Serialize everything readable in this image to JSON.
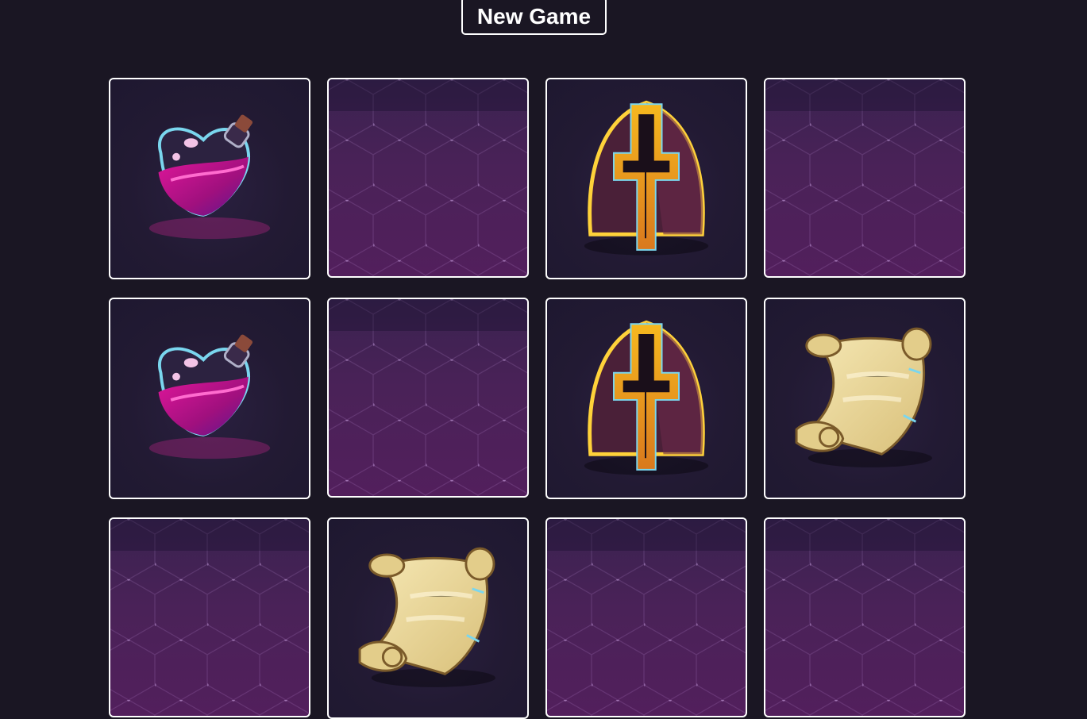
{
  "header": {
    "new_game_label": "New Game"
  },
  "board": {
    "cards": [
      {
        "state": "face-up",
        "item": "potion"
      },
      {
        "state": "face-down"
      },
      {
        "state": "face-up",
        "item": "helmet"
      },
      {
        "state": "face-down"
      },
      {
        "state": "face-up",
        "item": "potion"
      },
      {
        "state": "face-down"
      },
      {
        "state": "face-up",
        "item": "helmet"
      },
      {
        "state": "face-up",
        "item": "scroll"
      },
      {
        "state": "face-down"
      },
      {
        "state": "face-up",
        "item": "scroll"
      },
      {
        "state": "face-down"
      },
      {
        "state": "face-down"
      }
    ]
  },
  "icons": {
    "potion": "potion-icon",
    "helmet": "helmet-icon",
    "scroll": "scroll-icon",
    "card_back": "hexagon-pattern-icon"
  },
  "colors": {
    "background": "#1a1623",
    "card_border": "#ffffff",
    "card_back": "#4a2258"
  }
}
